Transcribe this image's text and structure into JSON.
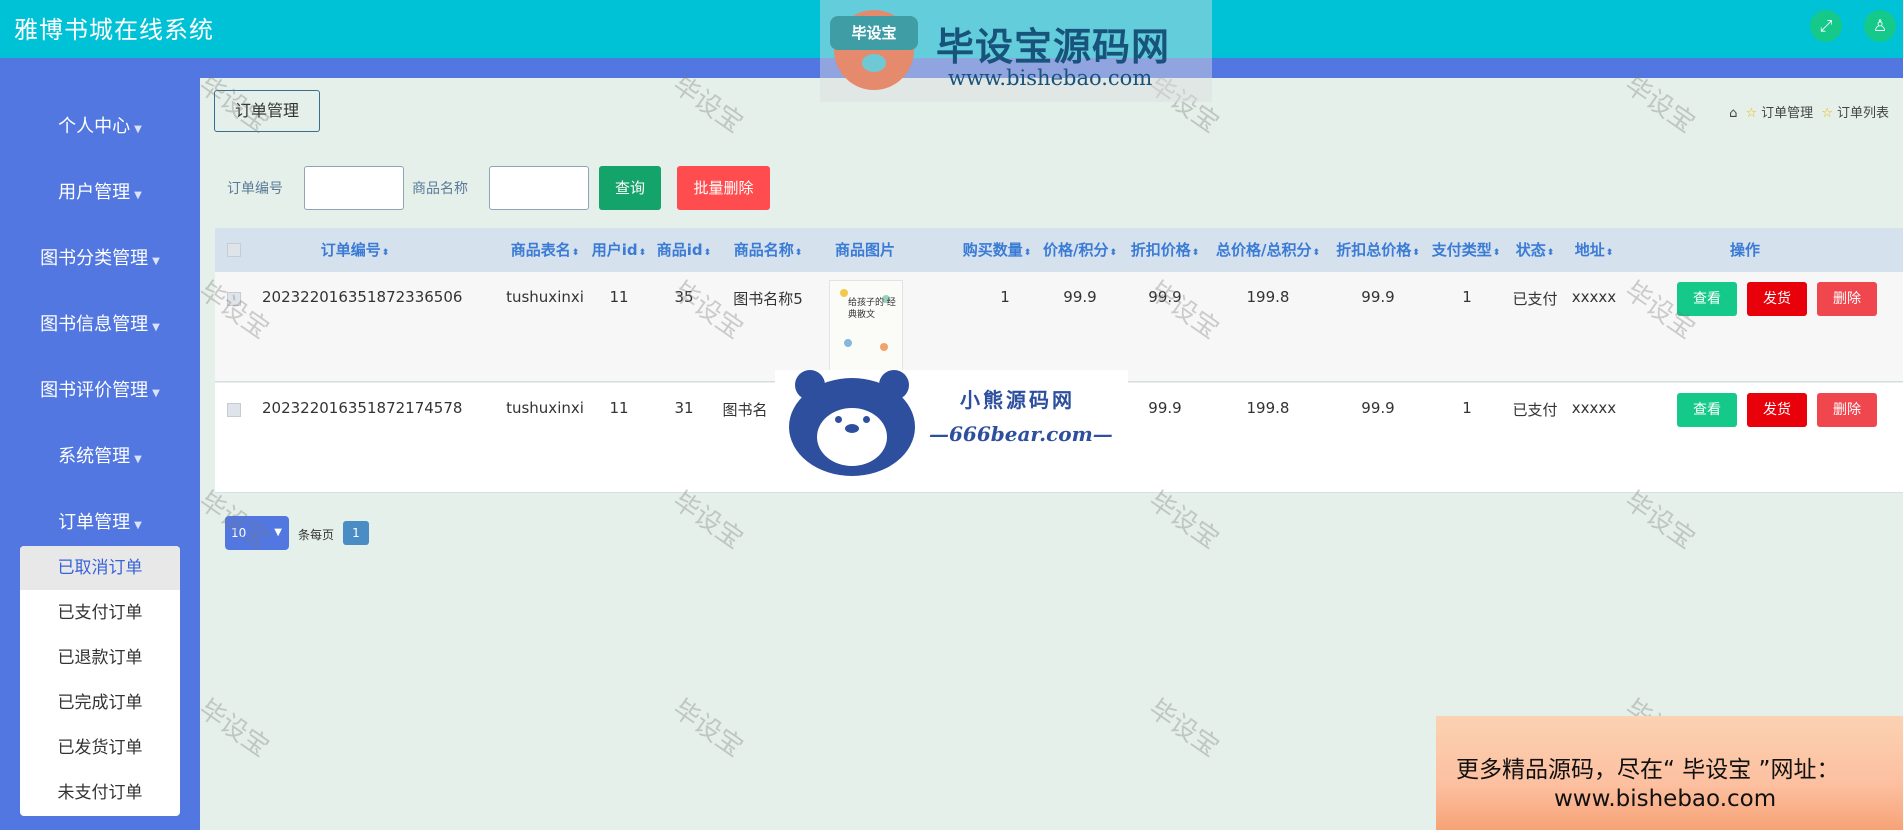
{
  "app": {
    "title": "雅博书城在线系统"
  },
  "header": {
    "fullscreen_icon": "fullscreen-icon",
    "user_icon": "user-icon"
  },
  "sidebar": {
    "items": [
      {
        "label": "个人中心"
      },
      {
        "label": "用户管理"
      },
      {
        "label": "图书分类管理"
      },
      {
        "label": "图书信息管理"
      },
      {
        "label": "图书评价管理"
      },
      {
        "label": "系统管理"
      },
      {
        "label": "订单管理"
      }
    ],
    "submenu": [
      {
        "label": "已取消订单",
        "active": true
      },
      {
        "label": "已支付订单"
      },
      {
        "label": "已退款订单"
      },
      {
        "label": "已完成订单"
      },
      {
        "label": "已发货订单"
      },
      {
        "label": "未支付订单"
      }
    ]
  },
  "page": {
    "tag": "订单管理",
    "breadcrumb": {
      "level1": "订单管理",
      "level2": "订单列表"
    }
  },
  "filters": {
    "order_no_label": "订单编号",
    "order_no_value": "",
    "goods_name_label": "商品名称",
    "goods_name_value": "",
    "search_label": "查询",
    "batch_delete_label": "批量删除"
  },
  "table": {
    "columns": [
      "订单编号",
      "商品表名",
      "用户id",
      "商品id",
      "商品名称",
      "商品图片",
      "购买数量",
      "价格/积分",
      "折扣价格",
      "总价格/总积分",
      "折扣总价格",
      "支付类型",
      "状态",
      "地址",
      "操作"
    ],
    "rows": [
      {
        "order_no": "202322016351872336506",
        "table_name": "tushuxinxi",
        "user_id": "11",
        "goods_id": "35",
        "goods_name": "图书名称5",
        "qty": "1",
        "price": "99.9",
        "discount_price": "99.9",
        "total": "199.8",
        "discount_total": "99.9",
        "pay_type": "1",
        "status": "已支付",
        "address": "xxxxx",
        "image_title": "给孩子的 经典散文"
      },
      {
        "order_no": "202322016351872174578",
        "table_name": "tushuxinxi",
        "user_id": "11",
        "goods_id": "31",
        "goods_name": "图书名",
        "qty": "",
        "price": "",
        "discount_price": "99.9",
        "total": "199.8",
        "discount_total": "99.9",
        "pay_type": "1",
        "status": "已支付",
        "address": "xxxxx",
        "image_title": ""
      }
    ],
    "actions": {
      "view": "查看",
      "ship": "发货",
      "delete": "删除"
    }
  },
  "pager": {
    "page_size": "10",
    "per_page_label": "条每页",
    "current_page": "1"
  },
  "watermarks": {
    "tile": "毕设宝",
    "logo_badge": "毕设宝",
    "logo_text": "毕设宝源码网",
    "logo_url": "www.bishebao.com",
    "bear_name": "小熊源码网",
    "bear_site": "—666bear.com—",
    "promo_line1": "更多精品源码，尽在“ 毕设宝 ”网址：",
    "promo_line2": "www.bishebao.com"
  },
  "colors": {
    "header": "#00c2d7",
    "sidebar": "#5277e0",
    "search": "#14a36a",
    "batch_delete": "#ff4d4f",
    "view": "#14c98a",
    "ship": "#e8000b",
    "delete": "#f0464d"
  }
}
